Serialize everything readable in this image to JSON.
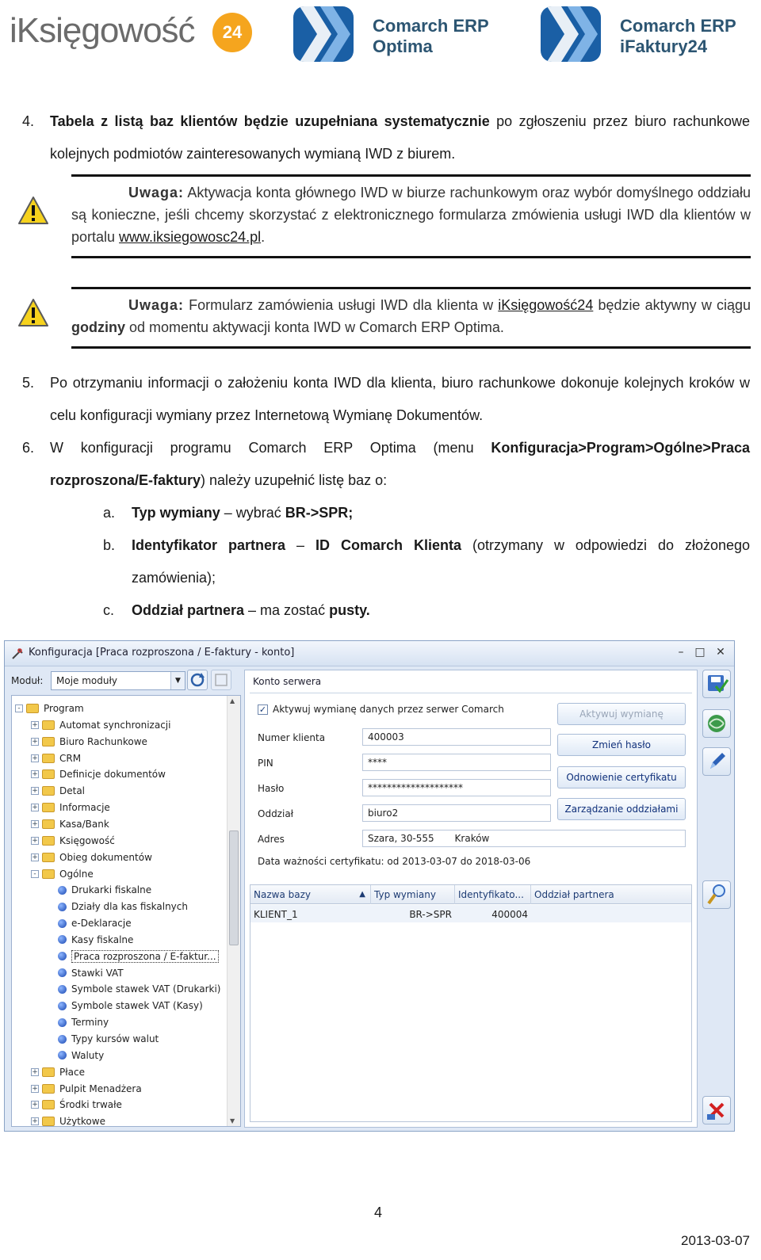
{
  "header": {
    "logo_main": "iKsięgowość",
    "logo_badge": "24",
    "logo2_line1": "Comarch ERP",
    "logo2_line2": "Optima",
    "logo3_line1": "Comarch ERP",
    "logo3_line2": "iFaktury24"
  },
  "section4": {
    "num": "4.",
    "bold": "Tabela z listą baz klientów będzie uzupełniana systematycznie",
    "rest": " po zgłoszeniu przez biuro rachunkowe kolejnych podmiotów zainteresowanych wymianą IWD z biurem."
  },
  "note1": {
    "label": "Uwaga:",
    "text": " Aktywacja konta głównego IWD w biurze rachunkowym oraz wybór domyślnego oddziału są konieczne, jeśli chcemy skorzystać z elektronicznego formularza zmówienia usługi IWD dla klientów w portalu ",
    "link": "www.iksiegowosc24.pl",
    "end": "."
  },
  "note2": {
    "label": "Uwaga:",
    "text1": " Formularz zamówienia usługi IWD dla klienta w ",
    "link": "iKsięgowość24",
    "text2": " będzie aktywny w ciągu ",
    "bold": "godziny",
    "text3": " od momentu aktywacji konta IWD w Comarch ERP Optima."
  },
  "section5": {
    "num": "5.",
    "text": "Po otrzymaniu informacji o założeniu konta IWD dla klienta, biuro rachunkowe dokonuje kolejnych kroków w celu konfiguracji wymiany przez Internetową Wymianę Dokumentów."
  },
  "section6": {
    "num": "6.",
    "text1": "W konfiguracji programu Comarch ERP Optima (menu ",
    "bold": "Konfiguracja>Program>Ogólne>Praca rozproszona/E-faktury",
    "text2": ") należy uzupełnić listę baz o:",
    "items": [
      {
        "letter": "a.",
        "b1": "Typ wymiany",
        "t1": " – wybrać ",
        "b2": "BR->SPR;",
        "t2": ""
      },
      {
        "letter": "b.",
        "b1": "Identyfikator partnera",
        "t1": " – ",
        "b2": "ID Comarch Klienta",
        "t2": " (otrzymany w odpowiedzi do złożonego zamówienia);"
      },
      {
        "letter": "c.",
        "b1": "Oddział partnera",
        "t1": " – ma zostać ",
        "b2": "pusty.",
        "t2": ""
      }
    ]
  },
  "window": {
    "title": "Konfiguracja [Praca rozproszona / E-faktury - konto]",
    "module_label": "Moduł:",
    "module_value": "Moje moduły",
    "tree": [
      {
        "label": "Program",
        "level": 0,
        "kind": "folder",
        "exp": "-"
      },
      {
        "label": "Automat synchronizacji",
        "level": 1,
        "kind": "folder",
        "exp": "+"
      },
      {
        "label": "Biuro Rachunkowe",
        "level": 1,
        "kind": "folder",
        "exp": "+"
      },
      {
        "label": "CRM",
        "level": 1,
        "kind": "folder",
        "exp": "+"
      },
      {
        "label": "Definicje dokumentów",
        "level": 1,
        "kind": "folder",
        "exp": "+"
      },
      {
        "label": "Detal",
        "level": 1,
        "kind": "folder",
        "exp": "+"
      },
      {
        "label": "Informacje",
        "level": 1,
        "kind": "folder",
        "exp": "+"
      },
      {
        "label": "Kasa/Bank",
        "level": 1,
        "kind": "folder",
        "exp": "+"
      },
      {
        "label": "Księgowość",
        "level": 1,
        "kind": "folder",
        "exp": "+"
      },
      {
        "label": "Obieg dokumentów",
        "level": 1,
        "kind": "folder",
        "exp": "+"
      },
      {
        "label": "Ogólne",
        "level": 1,
        "kind": "folder",
        "exp": "-"
      },
      {
        "label": "Drukarki fiskalne",
        "level": 2,
        "kind": "ball"
      },
      {
        "label": "Działy dla kas fiskalnych",
        "level": 2,
        "kind": "ball"
      },
      {
        "label": "e-Deklaracje",
        "level": 2,
        "kind": "ball"
      },
      {
        "label": "Kasy fiskalne",
        "level": 2,
        "kind": "ball"
      },
      {
        "label": "Praca rozproszona / E-faktur...",
        "level": 2,
        "kind": "ball",
        "selected": true
      },
      {
        "label": "Stawki VAT",
        "level": 2,
        "kind": "ball"
      },
      {
        "label": "Symbole stawek VAT (Drukarki)",
        "level": 2,
        "kind": "ball"
      },
      {
        "label": "Symbole stawek VAT (Kasy)",
        "level": 2,
        "kind": "ball"
      },
      {
        "label": "Terminy",
        "level": 2,
        "kind": "ball"
      },
      {
        "label": "Typy kursów walut",
        "level": 2,
        "kind": "ball"
      },
      {
        "label": "Waluty",
        "level": 2,
        "kind": "ball"
      },
      {
        "label": "Płace",
        "level": 1,
        "kind": "folder",
        "exp": "+"
      },
      {
        "label": "Pulpit Menadżera",
        "level": 1,
        "kind": "folder",
        "exp": "+"
      },
      {
        "label": "Środki trwałe",
        "level": 1,
        "kind": "folder",
        "exp": "+"
      },
      {
        "label": "Użytkowe",
        "level": 1,
        "kind": "folder",
        "exp": "+"
      }
    ],
    "pane_header": "Konto serwera",
    "checkbox_label": "Aktywuj wymianę danych przez serwer Comarch",
    "fields": [
      {
        "label": "Numer klienta",
        "value": "400003"
      },
      {
        "label": "PIN",
        "value": "****"
      },
      {
        "label": "Hasło",
        "value": "********************"
      },
      {
        "label": "Oddział",
        "value": "biuro2"
      }
    ],
    "address_label": "Adres",
    "address_value": "Szara, 30-555",
    "address_city": "Kraków",
    "buttons": [
      "Aktywuj wymianę",
      "Zmień hasło",
      "Odnowienie certyfikatu",
      "Zarządzanie oddziałami"
    ],
    "cert_text": "Data ważności certyfikatu:  od 2013-03-07  do 2018-03-06",
    "grid_headers": [
      "Nazwa bazy",
      "Typ wymiany",
      "Identyfikato...",
      "Oddział partnera"
    ],
    "grid_rows": [
      {
        "name": "KLIENT_1",
        "type": "BR->SPR",
        "id": "400004",
        "branch": ""
      }
    ]
  },
  "footer": {
    "page": "4",
    "date": "2013-03-07"
  }
}
